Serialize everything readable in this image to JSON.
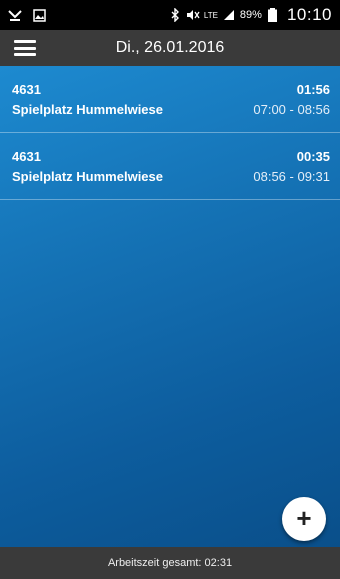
{
  "status_bar": {
    "battery": "89%",
    "time": "10:10",
    "network": "LTE",
    "icons": [
      "notification-icon",
      "image-icon",
      "bluetooth-icon",
      "mute-icon",
      "lte-icon",
      "signal-icon",
      "battery-icon"
    ]
  },
  "app_bar": {
    "title": "Di., 26.01.2016",
    "menu_icon": "hamburger-menu-icon"
  },
  "entries": [
    {
      "id": "4631",
      "name": "Spielplatz Hummelwiese",
      "duration": "01:56",
      "range": "07:00 - 08:56"
    },
    {
      "id": "4631",
      "name": "Spielplatz Hummelwiese",
      "duration": "00:35",
      "range": "08:56 - 09:31"
    }
  ],
  "fab": {
    "icon": "plus-icon",
    "label": "+"
  },
  "footer": {
    "text": "Arbeitszeit gesamt: 02:31"
  },
  "colors": {
    "accent_top": "#1d8ad0",
    "accent_bottom": "#0a4f8a",
    "bar": "#3a3a3a"
  }
}
